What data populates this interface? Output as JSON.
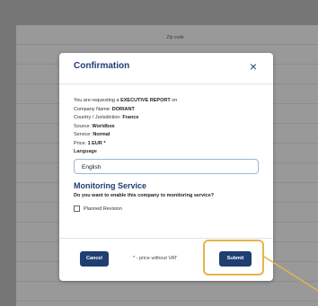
{
  "background": {
    "zip_label": "Zip code"
  },
  "modal": {
    "title": "Confirmation",
    "close_symbol": "×",
    "request_prefix": "You are requesting a ",
    "report_type": "EXECUTIVE REPORT",
    "request_suffix": " on",
    "company_label": "Company Name: ",
    "company_value": "DORIANT",
    "country_label": "Country / Jurisdiction: ",
    "country_value": "France",
    "source_label": "Source: ",
    "source_value": "Worldbox",
    "service_label": "Service: ",
    "service_value": "Normal",
    "price_label": "Price: ",
    "price_value": "1 EUR *",
    "language_label": "Language",
    "language_value": "English",
    "monitoring_title": "Monitoring Service",
    "monitoring_question": "Do you want to enable this company to monitoring service?",
    "planned_revision_label": "Planned Revision",
    "planned_revision_checked": false
  },
  "footer": {
    "cancel_label": "Cancel",
    "price_note": "* - price without VAT",
    "submit_label": "Submit"
  },
  "colors": {
    "primary": "#1f3e72",
    "highlight": "#e8b34a"
  }
}
